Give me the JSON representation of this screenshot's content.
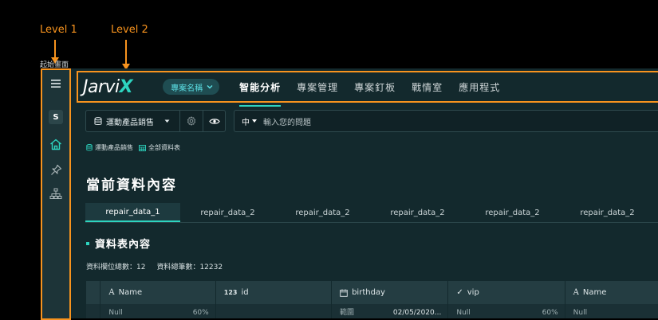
{
  "annotations": {
    "level1": "Level 1",
    "level2": "Level 2",
    "small_label": "起始畫面"
  },
  "sidebar": {
    "user_initial": "S"
  },
  "header": {
    "logo_main": "Jarvi",
    "logo_accent": "X",
    "project_pill": "專案名稱",
    "nav": [
      "智能分析",
      "專案管理",
      "專案釘板",
      "戰情室",
      "應用程式"
    ],
    "active_nav": "智能分析"
  },
  "toolbar": {
    "dataset": "運動產品銷售",
    "language": "中",
    "question_placeholder": "輸入您的問題"
  },
  "breadcrumb": {
    "dataset": "運動產品銷售",
    "all_tables": "全部資料表"
  },
  "page": {
    "title": "當前資料內容",
    "tabs": [
      "repair_data_1",
      "repair_data_2",
      "repair_data_2",
      "repair_data_2",
      "repair_data_2",
      "repair_data_2"
    ],
    "section_title": "資料表內容",
    "field_count_label": "資料欄位總數：12",
    "record_count_label": "資料總筆數：12232"
  },
  "table": {
    "columns": [
      {
        "icon": "text-type-icon",
        "glyph": "A",
        "label": "Name"
      },
      {
        "icon": "number-type-icon",
        "glyph": "123",
        "label": "id"
      },
      {
        "icon": "calendar-icon",
        "glyph": "",
        "label": "birthday"
      },
      {
        "icon": "check-icon",
        "glyph": "✓",
        "label": "vip"
      },
      {
        "icon": "text-type-icon",
        "glyph": "A",
        "label": "Name"
      }
    ],
    "row": [
      {
        "left": "Null",
        "right": "60%"
      },
      {
        "left": "",
        "right": ""
      },
      {
        "left": "範圍",
        "right": "02/05/2020..."
      },
      {
        "left": "Null",
        "right": "60%"
      },
      {
        "left": "Null",
        "right": ""
      }
    ]
  },
  "colors": {
    "accent": "#2dd4bf",
    "annotation": "#f7931e",
    "background": "#13292d",
    "sidebar": "#1d3438"
  }
}
